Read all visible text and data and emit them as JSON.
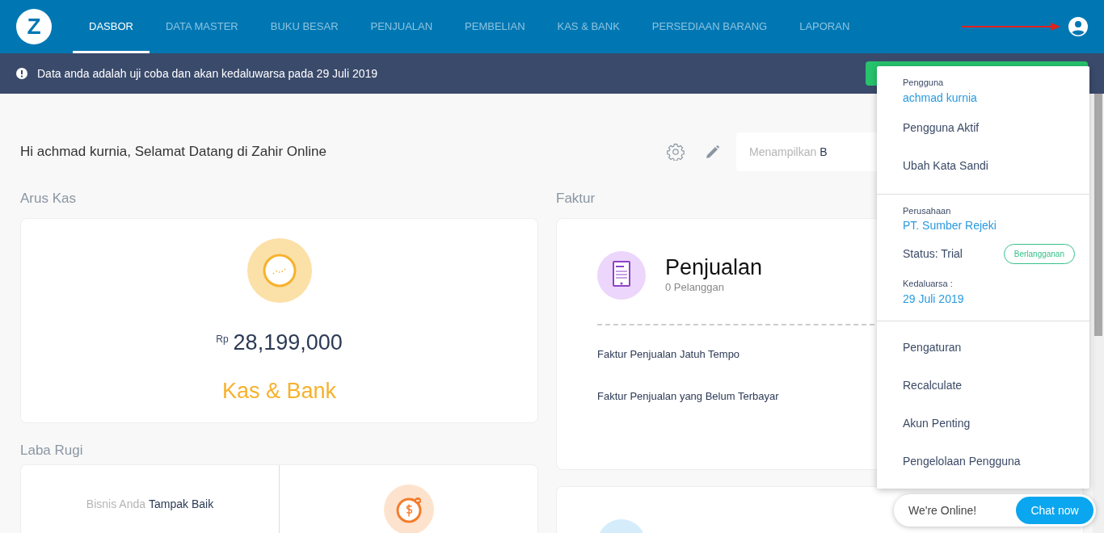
{
  "navbar": {
    "logo": "Z",
    "items": [
      {
        "label": "DASBOR",
        "selected": true
      },
      {
        "label": "DATA MASTER",
        "selected": false
      },
      {
        "label": "BUKU BESAR",
        "selected": false
      },
      {
        "label": "PENJUALAN",
        "selected": false
      },
      {
        "label": "PEMBELIAN",
        "selected": false
      },
      {
        "label": "KAS & BANK",
        "selected": false
      },
      {
        "label": "PERSEDIAAN BARANG",
        "selected": false
      },
      {
        "label": "LAPORAN",
        "selected": false
      }
    ]
  },
  "banner": {
    "message": "Data anda adalah uji coba dan akan kedaluwarsa pada 29 Juli 2019"
  },
  "header": {
    "greeting": "Hi achmad kurnia, Selamat Datang di Zahir Online",
    "display_label": "Menampilkan",
    "display_value": "B"
  },
  "arus_kas": {
    "title": "Arus Kas",
    "currency": "Rp",
    "amount": "28,199,000",
    "label": "Kas & Bank"
  },
  "laba_rugi": {
    "title": "Laba Rugi",
    "prefix": "Bisnis Anda",
    "status": "Tampak Baik"
  },
  "faktur": {
    "title": "Faktur",
    "card": {
      "title": "Penjualan",
      "subtitle": "0 Pelanggan",
      "links": [
        "Faktur Penjualan Jatuh Tempo",
        "Faktur Penjualan yang Belum Terbayar"
      ]
    }
  },
  "user_menu": {
    "user_label": "Pengguna",
    "user_name": "achmad kurnia",
    "user_items": [
      "Pengguna Aktif",
      "Ubah Kata Sandi"
    ],
    "company_label": "Perusahaan",
    "company_name": "PT. Sumber Rejeki",
    "status": "Status: Trial",
    "subscribe_button": "Berlangganan",
    "expiry_label": "Kedaluarsa :",
    "expiry_date": "29 Juli 2019",
    "items": [
      "Pengaturan",
      "Recalculate",
      "Akun Penting",
      "Pengelolaan Pengguna"
    ]
  },
  "chat": {
    "status": "We're Online!",
    "button": "Chat now"
  }
}
